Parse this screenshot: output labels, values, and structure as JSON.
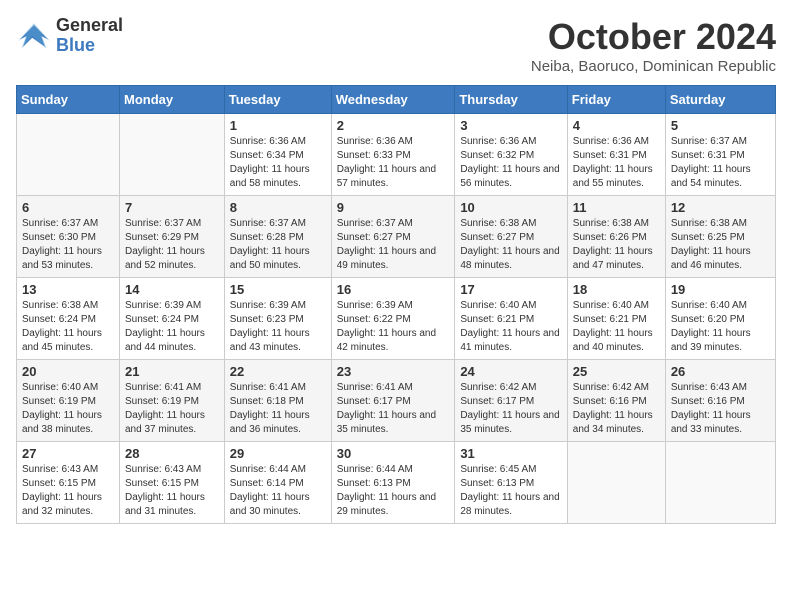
{
  "logo": {
    "line1": "General",
    "line2": "Blue"
  },
  "title": "October 2024",
  "subtitle": "Neiba, Baoruco, Dominican Republic",
  "days_of_week": [
    "Sunday",
    "Monday",
    "Tuesday",
    "Wednesday",
    "Thursday",
    "Friday",
    "Saturday"
  ],
  "weeks": [
    [
      {
        "day": "",
        "info": ""
      },
      {
        "day": "",
        "info": ""
      },
      {
        "day": "1",
        "info": "Sunrise: 6:36 AM\nSunset: 6:34 PM\nDaylight: 11 hours and 58 minutes."
      },
      {
        "day": "2",
        "info": "Sunrise: 6:36 AM\nSunset: 6:33 PM\nDaylight: 11 hours and 57 minutes."
      },
      {
        "day": "3",
        "info": "Sunrise: 6:36 AM\nSunset: 6:32 PM\nDaylight: 11 hours and 56 minutes."
      },
      {
        "day": "4",
        "info": "Sunrise: 6:36 AM\nSunset: 6:31 PM\nDaylight: 11 hours and 55 minutes."
      },
      {
        "day": "5",
        "info": "Sunrise: 6:37 AM\nSunset: 6:31 PM\nDaylight: 11 hours and 54 minutes."
      }
    ],
    [
      {
        "day": "6",
        "info": "Sunrise: 6:37 AM\nSunset: 6:30 PM\nDaylight: 11 hours and 53 minutes."
      },
      {
        "day": "7",
        "info": "Sunrise: 6:37 AM\nSunset: 6:29 PM\nDaylight: 11 hours and 52 minutes."
      },
      {
        "day": "8",
        "info": "Sunrise: 6:37 AM\nSunset: 6:28 PM\nDaylight: 11 hours and 50 minutes."
      },
      {
        "day": "9",
        "info": "Sunrise: 6:37 AM\nSunset: 6:27 PM\nDaylight: 11 hours and 49 minutes."
      },
      {
        "day": "10",
        "info": "Sunrise: 6:38 AM\nSunset: 6:27 PM\nDaylight: 11 hours and 48 minutes."
      },
      {
        "day": "11",
        "info": "Sunrise: 6:38 AM\nSunset: 6:26 PM\nDaylight: 11 hours and 47 minutes."
      },
      {
        "day": "12",
        "info": "Sunrise: 6:38 AM\nSunset: 6:25 PM\nDaylight: 11 hours and 46 minutes."
      }
    ],
    [
      {
        "day": "13",
        "info": "Sunrise: 6:38 AM\nSunset: 6:24 PM\nDaylight: 11 hours and 45 minutes."
      },
      {
        "day": "14",
        "info": "Sunrise: 6:39 AM\nSunset: 6:24 PM\nDaylight: 11 hours and 44 minutes."
      },
      {
        "day": "15",
        "info": "Sunrise: 6:39 AM\nSunset: 6:23 PM\nDaylight: 11 hours and 43 minutes."
      },
      {
        "day": "16",
        "info": "Sunrise: 6:39 AM\nSunset: 6:22 PM\nDaylight: 11 hours and 42 minutes."
      },
      {
        "day": "17",
        "info": "Sunrise: 6:40 AM\nSunset: 6:21 PM\nDaylight: 11 hours and 41 minutes."
      },
      {
        "day": "18",
        "info": "Sunrise: 6:40 AM\nSunset: 6:21 PM\nDaylight: 11 hours and 40 minutes."
      },
      {
        "day": "19",
        "info": "Sunrise: 6:40 AM\nSunset: 6:20 PM\nDaylight: 11 hours and 39 minutes."
      }
    ],
    [
      {
        "day": "20",
        "info": "Sunrise: 6:40 AM\nSunset: 6:19 PM\nDaylight: 11 hours and 38 minutes."
      },
      {
        "day": "21",
        "info": "Sunrise: 6:41 AM\nSunset: 6:19 PM\nDaylight: 11 hours and 37 minutes."
      },
      {
        "day": "22",
        "info": "Sunrise: 6:41 AM\nSunset: 6:18 PM\nDaylight: 11 hours and 36 minutes."
      },
      {
        "day": "23",
        "info": "Sunrise: 6:41 AM\nSunset: 6:17 PM\nDaylight: 11 hours and 35 minutes."
      },
      {
        "day": "24",
        "info": "Sunrise: 6:42 AM\nSunset: 6:17 PM\nDaylight: 11 hours and 35 minutes."
      },
      {
        "day": "25",
        "info": "Sunrise: 6:42 AM\nSunset: 6:16 PM\nDaylight: 11 hours and 34 minutes."
      },
      {
        "day": "26",
        "info": "Sunrise: 6:43 AM\nSunset: 6:16 PM\nDaylight: 11 hours and 33 minutes."
      }
    ],
    [
      {
        "day": "27",
        "info": "Sunrise: 6:43 AM\nSunset: 6:15 PM\nDaylight: 11 hours and 32 minutes."
      },
      {
        "day": "28",
        "info": "Sunrise: 6:43 AM\nSunset: 6:15 PM\nDaylight: 11 hours and 31 minutes."
      },
      {
        "day": "29",
        "info": "Sunrise: 6:44 AM\nSunset: 6:14 PM\nDaylight: 11 hours and 30 minutes."
      },
      {
        "day": "30",
        "info": "Sunrise: 6:44 AM\nSunset: 6:13 PM\nDaylight: 11 hours and 29 minutes."
      },
      {
        "day": "31",
        "info": "Sunrise: 6:45 AM\nSunset: 6:13 PM\nDaylight: 11 hours and 28 minutes."
      },
      {
        "day": "",
        "info": ""
      },
      {
        "day": "",
        "info": ""
      }
    ]
  ]
}
